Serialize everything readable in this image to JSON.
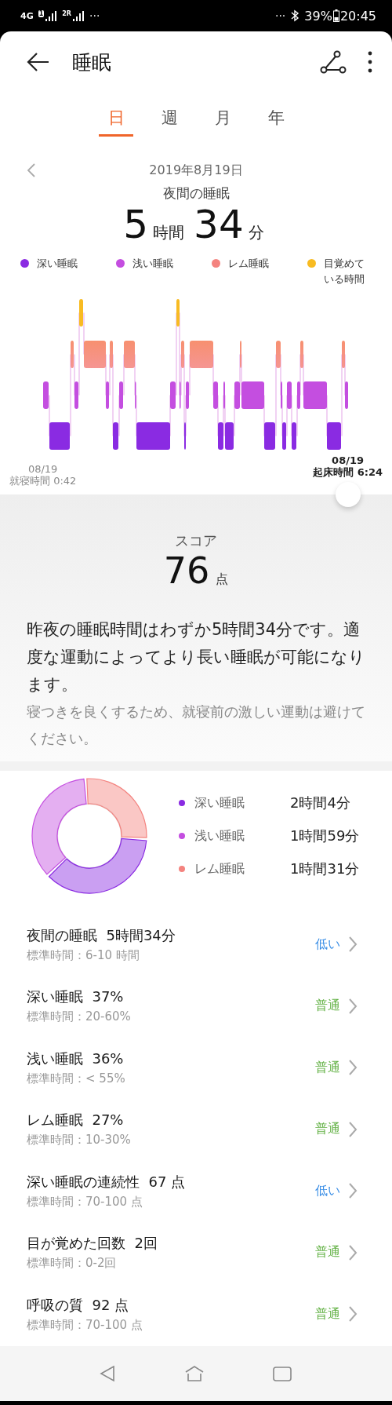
{
  "status_bar": {
    "network": "4G",
    "sim_1": "1",
    "sim_2": "2R",
    "overflow_left": "···",
    "overflow_right": "···",
    "battery": "39%",
    "time": "20:45"
  },
  "header": {
    "title": "睡眠"
  },
  "tabs": [
    {
      "label": "日",
      "selected": true
    },
    {
      "label": "週",
      "selected": false
    },
    {
      "label": "月",
      "selected": false
    },
    {
      "label": "年",
      "selected": false
    }
  ],
  "summary": {
    "date": "2019年8月19日",
    "caption": "夜間の睡眠",
    "hours": "5",
    "hours_unit": "時間",
    "minutes": "34",
    "minutes_unit": "分",
    "legend": [
      {
        "label": "深い睡眠",
        "color": "#8a2be2"
      },
      {
        "label": "浅い睡眠",
        "color": "#c44ee0"
      },
      {
        "label": "レム睡眠",
        "color": "#f4837f"
      },
      {
        "label": "目覚めている時間",
        "color": "#f8bb22"
      }
    ],
    "bedtime": {
      "date": "08/19",
      "label": "就寝時間 0:42"
    },
    "wake": {
      "date": "08/19",
      "label": "起床時間 6:24"
    }
  },
  "score": {
    "label": "スコア",
    "value": "76",
    "unit": "点",
    "message": "昨夜の睡眠時間はわずか5時間34分です。適度な運動によってより長い睡眠が可能になります。",
    "tip": "寝つきを良くするため、就寝前の激しい運動は避けてください。"
  },
  "breakdown": {
    "chart_data": {
      "type": "donut",
      "values": [
        37,
        36,
        27
      ]
    },
    "items": [
      {
        "label": "深い睡眠",
        "value": "2時間4分",
        "color": "#8a2be2"
      },
      {
        "label": "浅い睡眠",
        "value": "1時間59分",
        "color": "#c44ee0"
      },
      {
        "label": "レム睡眠",
        "value": "1時間31分",
        "color": "#f4837f"
      }
    ]
  },
  "metrics": [
    {
      "title": "夜間の睡眠  5時間34分",
      "range": "標準時間：6-10 時間",
      "rating": "低い",
      "kind": "low"
    },
    {
      "title": "深い睡眠  37%",
      "range": "標準時間：20-60%",
      "rating": "普通",
      "kind": "normal"
    },
    {
      "title": "浅い睡眠  36%",
      "range": "標準時間：< 55%",
      "rating": "普通",
      "kind": "normal"
    },
    {
      "title": "レム睡眠  27%",
      "range": "標準時間：10-30%",
      "rating": "普通",
      "kind": "normal"
    },
    {
      "title": "深い睡眠の連続性  67 点",
      "range": "標準時間：70-100 点",
      "rating": "低い",
      "kind": "low"
    },
    {
      "title": "目が覚めた回数  2回",
      "range": "標準時間：0-2回",
      "rating": "普通",
      "kind": "normal"
    },
    {
      "title": "呼吸の質  92 点",
      "range": "標準時間：70-100 点",
      "rating": "普通",
      "kind": "normal"
    }
  ]
}
